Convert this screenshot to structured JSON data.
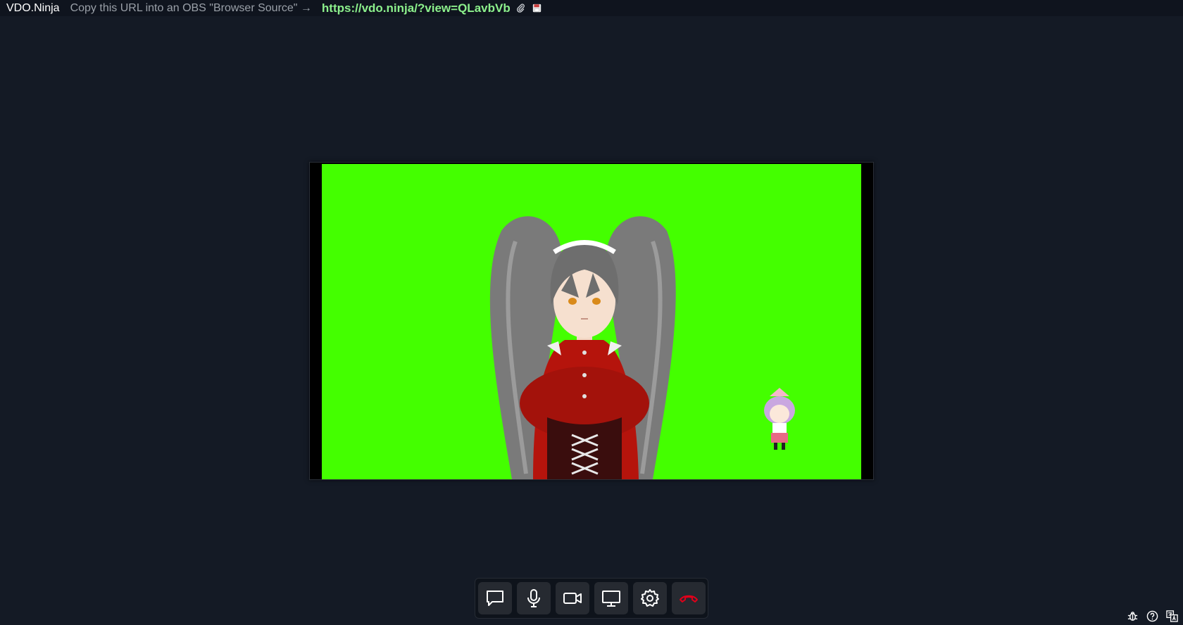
{
  "header": {
    "brand": "VDO.Ninja",
    "hint": "Copy this URL into an OBS \"Browser Source\" →",
    "share_url": "https://vdo.ninja/?view=QLavbVb",
    "icons": [
      "paperclip-icon",
      "save-icon"
    ]
  },
  "video": {
    "background_color": "#44ff00"
  },
  "controls": [
    {
      "name": "chat-button",
      "icon": "chat-bubble-icon"
    },
    {
      "name": "mic-button",
      "icon": "microphone-icon"
    },
    {
      "name": "camera-button",
      "icon": "video-camera-icon"
    },
    {
      "name": "screenshare-button",
      "icon": "monitor-icon"
    },
    {
      "name": "settings-button",
      "icon": "gear-icon"
    },
    {
      "name": "hangup-button",
      "icon": "phone-hangup-icon",
      "color": "#e0001a"
    }
  ],
  "corner": {
    "icons": [
      "bug-icon",
      "help-icon",
      "translate-icon"
    ]
  }
}
